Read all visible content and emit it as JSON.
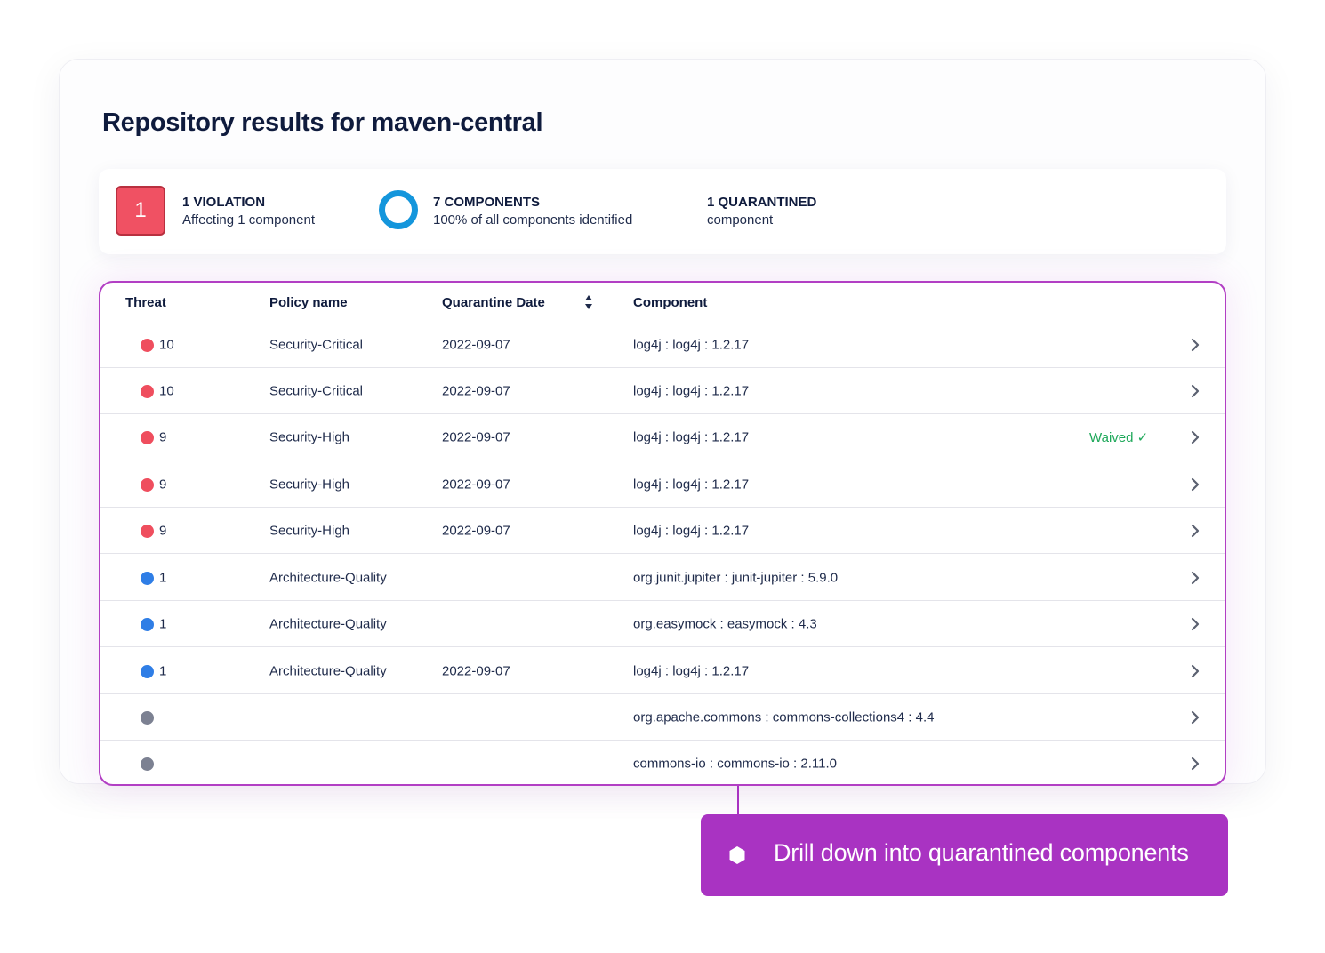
{
  "page_title": "Repository results for maven-central",
  "summary": {
    "violation_count": "1",
    "violation_title": "1 VIOLATION",
    "violation_sub": "Affecting 1 component",
    "components_title": "7 COMPONENTS",
    "components_sub": "100% of all components identified",
    "quarantined_title": "1 QUARANTINED",
    "quarantined_sub": "component"
  },
  "table": {
    "headers": {
      "threat": "Threat",
      "policy": "Policy name",
      "date": "Quarantine Date",
      "component": "Component"
    },
    "rows": [
      {
        "threat": "10",
        "level": "critical",
        "policy": "Security-Critical",
        "date": "2022-09-07",
        "component": "log4j : log4j : 1.2.17",
        "status": ""
      },
      {
        "threat": "10",
        "level": "critical",
        "policy": "Security-Critical",
        "date": "2022-09-07",
        "component": "log4j : log4j : 1.2.17",
        "status": ""
      },
      {
        "threat": "9",
        "level": "critical",
        "policy": "Security-High",
        "date": "2022-09-07",
        "component": "log4j : log4j : 1.2.17",
        "status": "Waived ✓"
      },
      {
        "threat": "9",
        "level": "critical",
        "policy": "Security-High",
        "date": "2022-09-07",
        "component": "log4j : log4j : 1.2.17",
        "status": ""
      },
      {
        "threat": "9",
        "level": "critical",
        "policy": "Security-High",
        "date": "2022-09-07",
        "component": "log4j : log4j : 1.2.17",
        "status": ""
      },
      {
        "threat": "1",
        "level": "low",
        "policy": "Architecture-Quality",
        "date": "",
        "component": "org.junit.jupiter : junit-jupiter : 5.9.0",
        "status": ""
      },
      {
        "threat": "1",
        "level": "low",
        "policy": "Architecture-Quality",
        "date": "",
        "component": "org.easymock : easymock : 4.3",
        "status": ""
      },
      {
        "threat": "1",
        "level": "low",
        "policy": "Architecture-Quality",
        "date": "2022-09-07",
        "component": "log4j : log4j : 1.2.17",
        "status": ""
      },
      {
        "threat": "",
        "level": "none",
        "policy": "",
        "date": "",
        "component": "org.apache.commons : commons-collections4 : 4.4",
        "status": ""
      },
      {
        "threat": "",
        "level": "none",
        "policy": "",
        "date": "",
        "component": "commons-io : commons-io : 2.11.0",
        "status": ""
      }
    ]
  },
  "colors": {
    "critical": "#ef4e5e",
    "low": "#2f7ee6",
    "none": "#7c8192",
    "accent": "#a933c2",
    "waived": "#1ea85a"
  },
  "callout": {
    "text": "Drill down into quarantined components",
    "icon": "hexagon-icon"
  }
}
